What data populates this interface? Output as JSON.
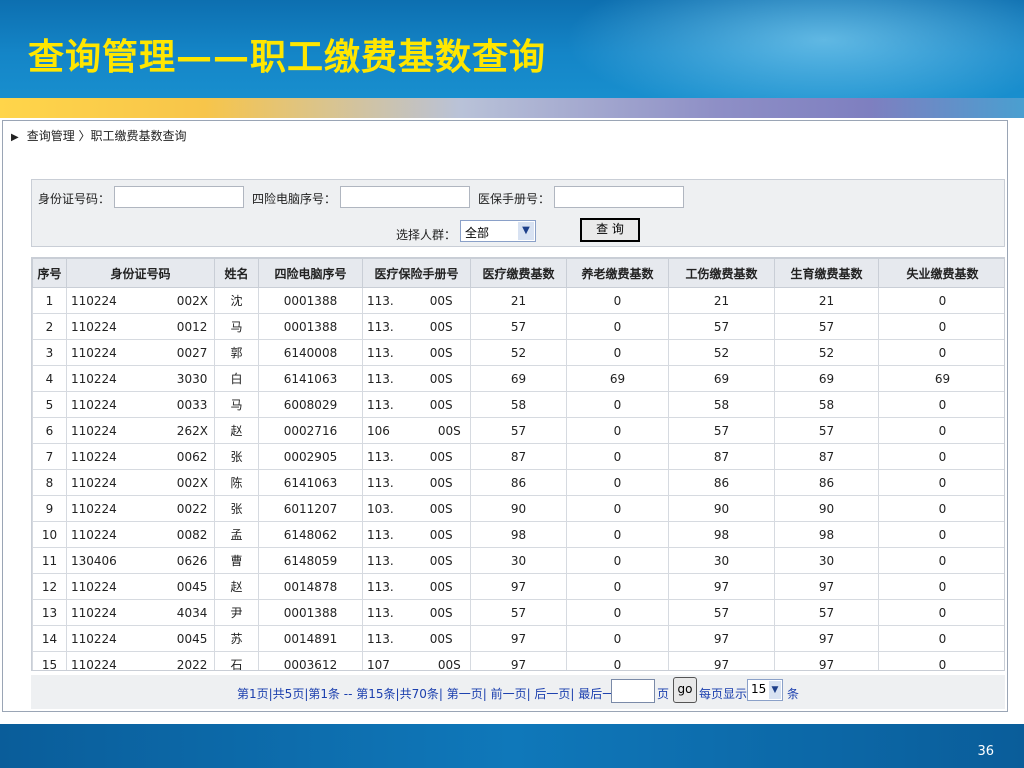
{
  "slide": {
    "title": "查询管理——职工缴费基数查询",
    "page_number": "36"
  },
  "breadcrumb": {
    "arrow": "▶",
    "text": "查询管理 〉职工缴费基数查询"
  },
  "search": {
    "id_label": "身份证号码：",
    "id_value": "",
    "pc_label": "四险电脑序号：",
    "pc_value": "",
    "med_label": "医保手册号：",
    "med_value": "",
    "group_label": "选择人群：",
    "group_value": "全部",
    "query_button": "查 询"
  },
  "table": {
    "columns": [
      "序号",
      "身份证号码",
      "姓名",
      "四险电脑序号",
      "医疗保险手册号",
      "医疗缴费基数",
      "养老缴费基数",
      "工伤缴费基数",
      "生育缴费基数",
      "失业缴费基数"
    ],
    "rows": [
      [
        "1",
        "110224　　　　　002X",
        "沈",
        "0001388",
        "113.　　　00S",
        "21",
        "0",
        "21",
        "21",
        "0"
      ],
      [
        "2",
        "110224　　　　　0012",
        "马",
        "0001388",
        "113.　　　00S",
        "57",
        "0",
        "57",
        "57",
        "0"
      ],
      [
        "3",
        "110224　　　　　0027",
        "郭",
        "6140008",
        "113.　　　00S",
        "52",
        "0",
        "52",
        "52",
        "0"
      ],
      [
        "4",
        "110224　　　　　3030",
        "白",
        "6141063",
        "113.　　　00S",
        "69",
        "69",
        "69",
        "69",
        "69"
      ],
      [
        "5",
        "110224　　　　　0033",
        "马",
        "6008029",
        "113.　　　00S",
        "58",
        "0",
        "58",
        "58",
        "0"
      ],
      [
        "6",
        "110224　　　　　262X",
        "赵",
        "0002716",
        "106　　　　00S",
        "57",
        "0",
        "57",
        "57",
        "0"
      ],
      [
        "7",
        "110224　　　　　0062",
        "张",
        "0002905",
        "113.　　　00S",
        "87",
        "0",
        "87",
        "87",
        "0"
      ],
      [
        "8",
        "110224　　　　　002X",
        "陈",
        "6141063",
        "113.　　　00S",
        "86",
        "0",
        "86",
        "86",
        "0"
      ],
      [
        "9",
        "110224　　　　　0022",
        "张",
        "6011207",
        "103.　　　00S",
        "90",
        "0",
        "90",
        "90",
        "0"
      ],
      [
        "10",
        "110224　　　　　0082",
        "孟",
        "6148062",
        "113.　　　00S",
        "98",
        "0",
        "98",
        "98",
        "0"
      ],
      [
        "11",
        "130406　　　　　0626",
        "曹",
        "6148059",
        "113.　　　00S",
        "30",
        "0",
        "30",
        "30",
        "0"
      ],
      [
        "12",
        "110224　　　　　0045",
        "赵",
        "0014878",
        "113.　　　00S",
        "97",
        "0",
        "97",
        "97",
        "0"
      ],
      [
        "13",
        "110224　　　　　4034",
        "尹",
        "0001388",
        "113.　　　00S",
        "57",
        "0",
        "57",
        "57",
        "0"
      ],
      [
        "14",
        "110224　　　　　0045",
        "苏",
        "0014891",
        "113.　　　00S",
        "97",
        "0",
        "97",
        "97",
        "0"
      ],
      [
        "15",
        "110224　　　　　2022",
        "石",
        "0003612",
        "107　　　　00S",
        "97",
        "0",
        "97",
        "97",
        "0"
      ]
    ]
  },
  "pager": {
    "text": "第1页|共5页|第1条 -- 第15条|共70条| 第一页| 前一页| 后一页| 最后一页| 第",
    "page_input": "",
    "page_suffix": "页",
    "go_label": "go",
    "show_prefix": "每页显示",
    "page_size": "15",
    "unit": "条"
  }
}
